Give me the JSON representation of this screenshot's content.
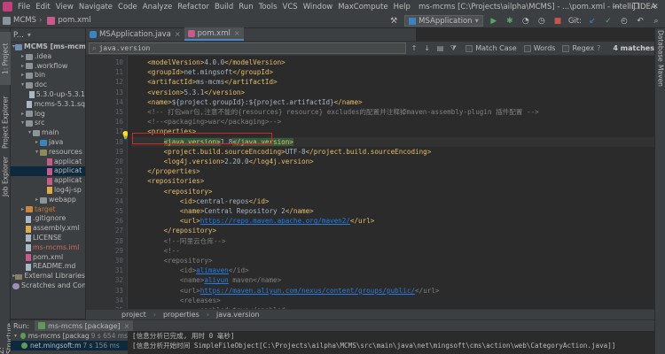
{
  "menubar": {
    "items": [
      "File",
      "Edit",
      "View",
      "Navigate",
      "Code",
      "Analyze",
      "Refactor",
      "Build",
      "Run",
      "Tools",
      "VCS",
      "Window",
      "MaxCompute",
      "Help"
    ],
    "title": "ms-mcms [C:\\Projects\\ailpha\\MCMS] - ...\\pom.xml - IntelliJ IDEA",
    "controls": [
      "—",
      "❐",
      "✕"
    ]
  },
  "navbar": {
    "crumbs": [
      "MCMS",
      "pom.xml"
    ],
    "run_config": "MSApplication",
    "git_label": "Git:"
  },
  "left_stripe": {
    "tabs": [
      "1: Project",
      "Job Explorer",
      "Project Explorer",
      "Z: Structure"
    ]
  },
  "right_stripe": {
    "tabs": [
      "Database",
      "Maven"
    ]
  },
  "project_panel": {
    "title": "P...",
    "tree": [
      {
        "label": "MCMS [ms-mcms]",
        "indent": 0,
        "arrow": "▾",
        "icon": "module",
        "bold": true
      },
      {
        "label": ".idea",
        "indent": 1,
        "arrow": "▸",
        "icon": "folder"
      },
      {
        "label": ".workflow",
        "indent": 1,
        "arrow": "▸",
        "icon": "folder"
      },
      {
        "label": "bin",
        "indent": 1,
        "arrow": "▸",
        "icon": "folder"
      },
      {
        "label": "doc",
        "indent": 1,
        "arrow": "▾",
        "icon": "folder"
      },
      {
        "label": "5.3.0-up-5.3.1",
        "indent": 2,
        "arrow": "",
        "icon": "file"
      },
      {
        "label": "mcms-5.3.1.sq",
        "indent": 2,
        "arrow": "",
        "icon": "file"
      },
      {
        "label": "log",
        "indent": 1,
        "arrow": "▸",
        "icon": "folder"
      },
      {
        "label": "src",
        "indent": 1,
        "arrow": "▾",
        "icon": "folder"
      },
      {
        "label": "main",
        "indent": 2,
        "arrow": "▾",
        "icon": "folder"
      },
      {
        "label": "java",
        "indent": 3,
        "arrow": "▸",
        "icon": "folder-src"
      },
      {
        "label": "resources",
        "indent": 3,
        "arrow": "▾",
        "icon": "folder-res"
      },
      {
        "label": "applicat",
        "indent": 4,
        "arrow": "",
        "icon": "file-pink"
      },
      {
        "label": "applicat",
        "indent": 4,
        "arrow": "",
        "icon": "file-pink",
        "selected": true
      },
      {
        "label": "applicat",
        "indent": 4,
        "arrow": "",
        "icon": "file-pink"
      },
      {
        "label": "log4j-sp",
        "indent": 4,
        "arrow": "",
        "icon": "file-xml"
      },
      {
        "label": "webapp",
        "indent": 3,
        "arrow": "▸",
        "icon": "folder"
      },
      {
        "label": "target",
        "indent": 1,
        "arrow": "▸",
        "icon": "folder-orange",
        "color": "orange"
      },
      {
        "label": ".gitignore",
        "indent": 1,
        "arrow": "",
        "icon": "file"
      },
      {
        "label": "assembly.xml",
        "indent": 1,
        "arrow": "",
        "icon": "file-xml"
      },
      {
        "label": "LICENSE",
        "indent": 1,
        "arrow": "",
        "icon": "file"
      },
      {
        "label": "ms-mcms.iml",
        "indent": 1,
        "arrow": "",
        "icon": "file",
        "color": "red"
      },
      {
        "label": "pom.xml",
        "indent": 1,
        "arrow": "",
        "icon": "file-pink"
      },
      {
        "label": "README.md",
        "indent": 1,
        "arrow": "",
        "icon": "file"
      },
      {
        "label": "External Libraries",
        "indent": 0,
        "arrow": "▸",
        "icon": "lib"
      },
      {
        "label": "Scratches and Conso",
        "indent": 0,
        "arrow": "",
        "icon": "scratch"
      }
    ]
  },
  "editor_tabs": [
    {
      "label": "MSApplication.java",
      "icon_color": "#3c83c4",
      "active": false
    },
    {
      "label": "pom.xml",
      "icon_color": "#c75c8a",
      "active": true
    }
  ],
  "findbar": {
    "query": "java.version",
    "match_case": "Match Case",
    "words": "Words",
    "regex": "Regex",
    "matches": "4 matches"
  },
  "code": {
    "first_line": 10,
    "caret_line": 18,
    "lines": [
      [
        [
          "    ",
          ""
        ],
        [
          "<modelVersion>",
          "tag"
        ],
        [
          "4.0.0",
          "txt"
        ],
        [
          "</modelVersion>",
          "tag"
        ]
      ],
      [
        [
          "    ",
          ""
        ],
        [
          "<groupId>",
          "tag"
        ],
        [
          "net.mingsoft",
          "txt"
        ],
        [
          "</groupId>",
          "tag"
        ]
      ],
      [
        [
          "    ",
          ""
        ],
        [
          "<artifactId>",
          "tag"
        ],
        [
          "ms-mcms",
          "txt"
        ],
        [
          "</artifactId>",
          "tag"
        ]
      ],
      [
        [
          "    ",
          ""
        ],
        [
          "<version>",
          "tag"
        ],
        [
          "5.3.1",
          "txt"
        ],
        [
          "</version>",
          "tag"
        ]
      ],
      [
        [
          "    ",
          ""
        ],
        [
          "<name>",
          "tag"
        ],
        [
          "${project.groupId}:${project.artifactId}",
          "txt"
        ],
        [
          "</name>",
          "tag"
        ]
      ],
      [
        [
          "    ",
          ""
        ],
        [
          "<!-- 打包war包,注意不能的{resources} resource} excludes的配置并注释掉maven-assembly-plugin 插件配置 -->",
          "cmt"
        ]
      ],
      [
        [
          "    ",
          ""
        ],
        [
          "<!--<packaging>war</packaging>-->",
          "cmt"
        ]
      ],
      [
        [
          "    ",
          ""
        ],
        [
          "<properties>",
          "tag"
        ]
      ],
      [
        [
          "        ",
          ""
        ],
        [
          "<java.version>",
          "tag hl"
        ],
        [
          "1.8",
          "txt"
        ],
        [
          "</java.version>",
          "tag hl"
        ]
      ],
      [
        [
          "        ",
          ""
        ],
        [
          "<project.build.sourceEncoding>",
          "tag"
        ],
        [
          "UTF-8",
          "txt"
        ],
        [
          "</project.build.sourceEncoding>",
          "tag"
        ]
      ],
      [
        [
          "        ",
          ""
        ],
        [
          "<log4j.version>",
          "tag"
        ],
        [
          "2.20.0",
          "txt"
        ],
        [
          "</log4j.version>",
          "tag"
        ]
      ],
      [
        [
          "    ",
          ""
        ],
        [
          "</properties>",
          "tag"
        ]
      ],
      [
        [
          "    ",
          ""
        ],
        [
          "<repositories>",
          "tag"
        ]
      ],
      [
        [
          "        ",
          ""
        ],
        [
          "<repository>",
          "tag"
        ]
      ],
      [
        [
          "            ",
          ""
        ],
        [
          "<id>",
          "tag"
        ],
        [
          "central-repos",
          "txt"
        ],
        [
          "</id>",
          "tag"
        ]
      ],
      [
        [
          "            ",
          ""
        ],
        [
          "<name>",
          "tag"
        ],
        [
          "Central Repository 2",
          "txt"
        ],
        [
          "</name>",
          "tag"
        ]
      ],
      [
        [
          "            ",
          ""
        ],
        [
          "<url>",
          "tag"
        ],
        [
          "https://repo.maven.apache.org/maven2/",
          "lnk"
        ],
        [
          "</url>",
          "tag"
        ]
      ],
      [
        [
          "        ",
          ""
        ],
        [
          "</repository>",
          "tag"
        ]
      ],
      [
        [
          "        ",
          ""
        ],
        [
          "<!--阿里云仓库-->",
          "cmt"
        ]
      ],
      [
        [
          "        ",
          ""
        ],
        [
          "<!--",
          "cmt"
        ]
      ],
      [
        [
          "        ",
          ""
        ],
        [
          "<repository>",
          "cmt"
        ]
      ],
      [
        [
          "            ",
          ""
        ],
        [
          "<id>",
          "cmt"
        ],
        [
          "alimaven",
          "lnk"
        ],
        [
          "</id>",
          "cmt"
        ]
      ],
      [
        [
          "            ",
          ""
        ],
        [
          "<name>",
          "cmt"
        ],
        [
          "aliyun",
          "lnk"
        ],
        [
          " maven</name>",
          "cmt"
        ]
      ],
      [
        [
          "            ",
          ""
        ],
        [
          "<url>",
          "cmt"
        ],
        [
          "https://maven.aliyun.com/nexus/content/groups/public/",
          "lnk"
        ],
        [
          "</url>",
          "cmt"
        ]
      ],
      [
        [
          "            ",
          ""
        ],
        [
          "<releases>",
          "cmt"
        ]
      ],
      [
        [
          "                ",
          ""
        ],
        [
          "<enabled>true</enabled>",
          "cmt"
        ]
      ]
    ]
  },
  "breadcrumb": [
    "project",
    "properties",
    "java.version"
  ],
  "run_panel": {
    "label": "Run:",
    "tab": "ms-mcms [package]",
    "tree": [
      {
        "label": "ms-mcms [packag",
        "time": "9 s 654 ms",
        "status_color": "#5f9a5c",
        "arrow": "▾"
      },
      {
        "label": "net.mingsoft:m",
        "time": "7 s 156 ms",
        "status_color": "#5f9a5c",
        "arrow": "",
        "selected": true
      }
    ],
    "console": [
      "[信息分析已完成, 用时 0 毫秒]",
      "[信息分析开始时间 SimpleFileObject[C:\\Projects\\ailpha\\MCMS\\src\\main\\java\\net\\mingsoft\\cms\\action\\web\\CategoryAction.java]]"
    ]
  },
  "colors": {
    "background": "#2b2b2b",
    "panel": "#3c3f41",
    "tag": "#e8bf6a",
    "comment": "#808080",
    "link": "#287bde",
    "highlight_box": "#d7261e"
  }
}
